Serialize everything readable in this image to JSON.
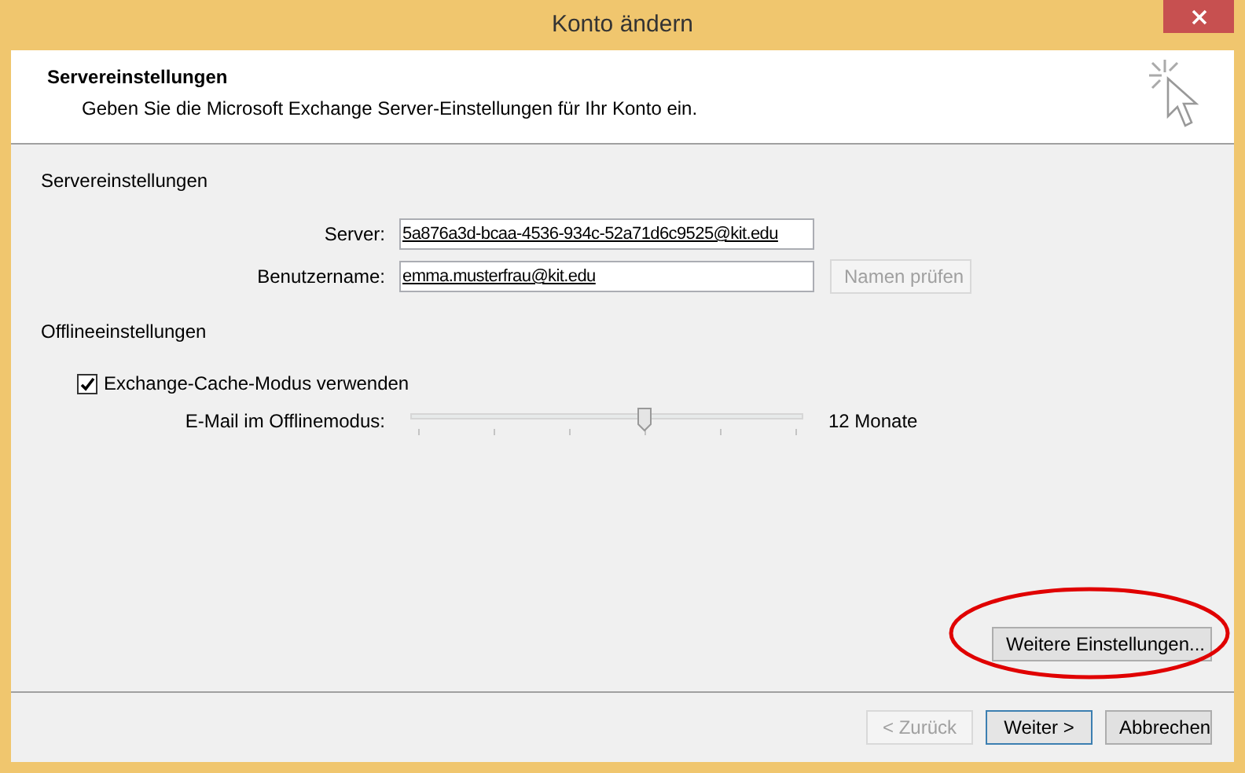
{
  "window": {
    "title": "Konto ändern"
  },
  "header": {
    "title": "Servereinstellungen",
    "subtitle": "Geben Sie die Microsoft Exchange Server-Einstellungen für Ihr Konto ein."
  },
  "server_section": {
    "title": "Servereinstellungen",
    "fields": [
      {
        "label": "Server:",
        "value": "5a876a3d-bcaa-4536-934c-52a71d6c9525@kit.edu"
      },
      {
        "label": "Benutzername:",
        "value": "emma.musterfrau@kit.edu"
      }
    ],
    "check_button": {
      "label": "Namen prüfen",
      "disabled": true
    }
  },
  "offline_section": {
    "title": "Offlineeinstellungen",
    "cache_mode": {
      "label": "Exchange-Cache-Modus verwenden",
      "checked": true
    },
    "slider": {
      "label": "E-Mail im Offlinemodus:",
      "level": 0.6,
      "reading": "12 Monate"
    }
  },
  "more_settings_button": {
    "label": "Weitere Einstellungen..."
  },
  "buttons": [
    {
      "label": "< Zurück",
      "disabled": true,
      "default": false
    },
    {
      "label": "Weiter >",
      "disabled": false,
      "default": true
    },
    {
      "label": "Abbrechen",
      "disabled": false,
      "default": false
    }
  ]
}
